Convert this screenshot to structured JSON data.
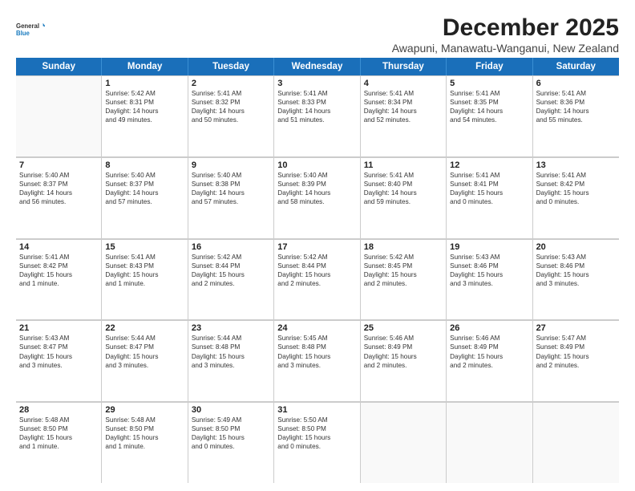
{
  "logo": {
    "line1": "General",
    "line2": "Blue"
  },
  "title": "December 2025",
  "subtitle": "Awapuni, Manawatu-Wanganui, New Zealand",
  "header_days": [
    "Sunday",
    "Monday",
    "Tuesday",
    "Wednesday",
    "Thursday",
    "Friday",
    "Saturday"
  ],
  "weeks": [
    [
      {
        "day": "",
        "lines": []
      },
      {
        "day": "1",
        "lines": [
          "Sunrise: 5:42 AM",
          "Sunset: 8:31 PM",
          "Daylight: 14 hours",
          "and 49 minutes."
        ]
      },
      {
        "day": "2",
        "lines": [
          "Sunrise: 5:41 AM",
          "Sunset: 8:32 PM",
          "Daylight: 14 hours",
          "and 50 minutes."
        ]
      },
      {
        "day": "3",
        "lines": [
          "Sunrise: 5:41 AM",
          "Sunset: 8:33 PM",
          "Daylight: 14 hours",
          "and 51 minutes."
        ]
      },
      {
        "day": "4",
        "lines": [
          "Sunrise: 5:41 AM",
          "Sunset: 8:34 PM",
          "Daylight: 14 hours",
          "and 52 minutes."
        ]
      },
      {
        "day": "5",
        "lines": [
          "Sunrise: 5:41 AM",
          "Sunset: 8:35 PM",
          "Daylight: 14 hours",
          "and 54 minutes."
        ]
      },
      {
        "day": "6",
        "lines": [
          "Sunrise: 5:41 AM",
          "Sunset: 8:36 PM",
          "Daylight: 14 hours",
          "and 55 minutes."
        ]
      }
    ],
    [
      {
        "day": "7",
        "lines": [
          "Sunrise: 5:40 AM",
          "Sunset: 8:37 PM",
          "Daylight: 14 hours",
          "and 56 minutes."
        ]
      },
      {
        "day": "8",
        "lines": [
          "Sunrise: 5:40 AM",
          "Sunset: 8:37 PM",
          "Daylight: 14 hours",
          "and 57 minutes."
        ]
      },
      {
        "day": "9",
        "lines": [
          "Sunrise: 5:40 AM",
          "Sunset: 8:38 PM",
          "Daylight: 14 hours",
          "and 57 minutes."
        ]
      },
      {
        "day": "10",
        "lines": [
          "Sunrise: 5:40 AM",
          "Sunset: 8:39 PM",
          "Daylight: 14 hours",
          "and 58 minutes."
        ]
      },
      {
        "day": "11",
        "lines": [
          "Sunrise: 5:41 AM",
          "Sunset: 8:40 PM",
          "Daylight: 14 hours",
          "and 59 minutes."
        ]
      },
      {
        "day": "12",
        "lines": [
          "Sunrise: 5:41 AM",
          "Sunset: 8:41 PM",
          "Daylight: 15 hours",
          "and 0 minutes."
        ]
      },
      {
        "day": "13",
        "lines": [
          "Sunrise: 5:41 AM",
          "Sunset: 8:42 PM",
          "Daylight: 15 hours",
          "and 0 minutes."
        ]
      }
    ],
    [
      {
        "day": "14",
        "lines": [
          "Sunrise: 5:41 AM",
          "Sunset: 8:42 PM",
          "Daylight: 15 hours",
          "and 1 minute."
        ]
      },
      {
        "day": "15",
        "lines": [
          "Sunrise: 5:41 AM",
          "Sunset: 8:43 PM",
          "Daylight: 15 hours",
          "and 1 minute."
        ]
      },
      {
        "day": "16",
        "lines": [
          "Sunrise: 5:42 AM",
          "Sunset: 8:44 PM",
          "Daylight: 15 hours",
          "and 2 minutes."
        ]
      },
      {
        "day": "17",
        "lines": [
          "Sunrise: 5:42 AM",
          "Sunset: 8:44 PM",
          "Daylight: 15 hours",
          "and 2 minutes."
        ]
      },
      {
        "day": "18",
        "lines": [
          "Sunrise: 5:42 AM",
          "Sunset: 8:45 PM",
          "Daylight: 15 hours",
          "and 2 minutes."
        ]
      },
      {
        "day": "19",
        "lines": [
          "Sunrise: 5:43 AM",
          "Sunset: 8:46 PM",
          "Daylight: 15 hours",
          "and 3 minutes."
        ]
      },
      {
        "day": "20",
        "lines": [
          "Sunrise: 5:43 AM",
          "Sunset: 8:46 PM",
          "Daylight: 15 hours",
          "and 3 minutes."
        ]
      }
    ],
    [
      {
        "day": "21",
        "lines": [
          "Sunrise: 5:43 AM",
          "Sunset: 8:47 PM",
          "Daylight: 15 hours",
          "and 3 minutes."
        ]
      },
      {
        "day": "22",
        "lines": [
          "Sunrise: 5:44 AM",
          "Sunset: 8:47 PM",
          "Daylight: 15 hours",
          "and 3 minutes."
        ]
      },
      {
        "day": "23",
        "lines": [
          "Sunrise: 5:44 AM",
          "Sunset: 8:48 PM",
          "Daylight: 15 hours",
          "and 3 minutes."
        ]
      },
      {
        "day": "24",
        "lines": [
          "Sunrise: 5:45 AM",
          "Sunset: 8:48 PM",
          "Daylight: 15 hours",
          "and 3 minutes."
        ]
      },
      {
        "day": "25",
        "lines": [
          "Sunrise: 5:46 AM",
          "Sunset: 8:49 PM",
          "Daylight: 15 hours",
          "and 2 minutes."
        ]
      },
      {
        "day": "26",
        "lines": [
          "Sunrise: 5:46 AM",
          "Sunset: 8:49 PM",
          "Daylight: 15 hours",
          "and 2 minutes."
        ]
      },
      {
        "day": "27",
        "lines": [
          "Sunrise: 5:47 AM",
          "Sunset: 8:49 PM",
          "Daylight: 15 hours",
          "and 2 minutes."
        ]
      }
    ],
    [
      {
        "day": "28",
        "lines": [
          "Sunrise: 5:48 AM",
          "Sunset: 8:50 PM",
          "Daylight: 15 hours",
          "and 1 minute."
        ]
      },
      {
        "day": "29",
        "lines": [
          "Sunrise: 5:48 AM",
          "Sunset: 8:50 PM",
          "Daylight: 15 hours",
          "and 1 minute."
        ]
      },
      {
        "day": "30",
        "lines": [
          "Sunrise: 5:49 AM",
          "Sunset: 8:50 PM",
          "Daylight: 15 hours",
          "and 0 minutes."
        ]
      },
      {
        "day": "31",
        "lines": [
          "Sunrise: 5:50 AM",
          "Sunset: 8:50 PM",
          "Daylight: 15 hours",
          "and 0 minutes."
        ]
      },
      {
        "day": "",
        "lines": []
      },
      {
        "day": "",
        "lines": []
      },
      {
        "day": "",
        "lines": []
      }
    ]
  ]
}
